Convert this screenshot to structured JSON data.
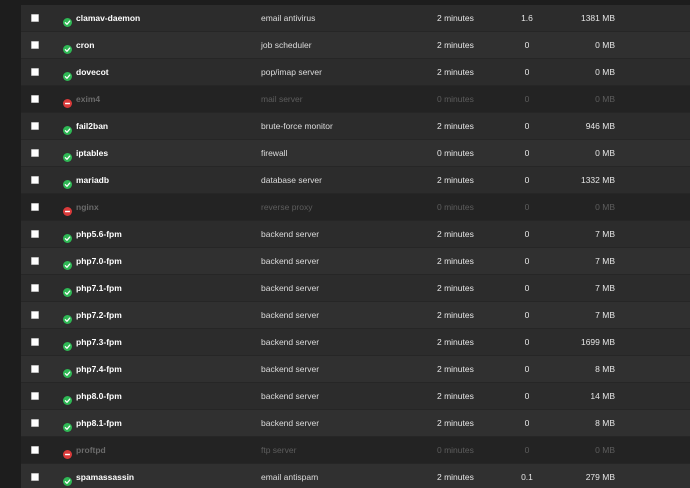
{
  "colors": {
    "running": "#2fb855",
    "stopped": "#d93a3a"
  },
  "services": [
    {
      "name": "clamav-daemon",
      "description": "email antivirus",
      "uptime": "2 minutes",
      "cpu": "1.6",
      "memory": "1381 MB",
      "status": "running",
      "status_icon": "check-circle-icon"
    },
    {
      "name": "cron",
      "description": "job scheduler",
      "uptime": "2 minutes",
      "cpu": "0",
      "memory": "0 MB",
      "status": "running",
      "status_icon": "check-circle-icon"
    },
    {
      "name": "dovecot",
      "description": "pop/imap server",
      "uptime": "2 minutes",
      "cpu": "0",
      "memory": "0 MB",
      "status": "running",
      "status_icon": "check-circle-icon"
    },
    {
      "name": "exim4",
      "description": "mail server",
      "uptime": "0 minutes",
      "cpu": "0",
      "memory": "0 MB",
      "status": "stopped",
      "status_icon": "minus-circle-icon"
    },
    {
      "name": "fail2ban",
      "description": "brute-force monitor",
      "uptime": "2 minutes",
      "cpu": "0",
      "memory": "946 MB",
      "status": "running",
      "status_icon": "check-circle-icon"
    },
    {
      "name": "iptables",
      "description": "firewall",
      "uptime": "0 minutes",
      "cpu": "0",
      "memory": "0 MB",
      "status": "running",
      "status_icon": "check-circle-icon"
    },
    {
      "name": "mariadb",
      "description": "database server",
      "uptime": "2 minutes",
      "cpu": "0",
      "memory": "1332 MB",
      "status": "running",
      "status_icon": "check-circle-icon"
    },
    {
      "name": "nginx",
      "description": "reverse proxy",
      "uptime": "0 minutes",
      "cpu": "0",
      "memory": "0 MB",
      "status": "stopped",
      "status_icon": "minus-circle-icon"
    },
    {
      "name": "php5.6-fpm",
      "description": "backend server",
      "uptime": "2 minutes",
      "cpu": "0",
      "memory": "7 MB",
      "status": "running",
      "status_icon": "check-circle-icon"
    },
    {
      "name": "php7.0-fpm",
      "description": "backend server",
      "uptime": "2 minutes",
      "cpu": "0",
      "memory": "7 MB",
      "status": "running",
      "status_icon": "check-circle-icon"
    },
    {
      "name": "php7.1-fpm",
      "description": "backend server",
      "uptime": "2 minutes",
      "cpu": "0",
      "memory": "7 MB",
      "status": "running",
      "status_icon": "check-circle-icon"
    },
    {
      "name": "php7.2-fpm",
      "description": "backend server",
      "uptime": "2 minutes",
      "cpu": "0",
      "memory": "7 MB",
      "status": "running",
      "status_icon": "check-circle-icon"
    },
    {
      "name": "php7.3-fpm",
      "description": "backend server",
      "uptime": "2 minutes",
      "cpu": "0",
      "memory": "1699 MB",
      "status": "running",
      "status_icon": "check-circle-icon"
    },
    {
      "name": "php7.4-fpm",
      "description": "backend server",
      "uptime": "2 minutes",
      "cpu": "0",
      "memory": "8 MB",
      "status": "running",
      "status_icon": "check-circle-icon"
    },
    {
      "name": "php8.0-fpm",
      "description": "backend server",
      "uptime": "2 minutes",
      "cpu": "0",
      "memory": "14 MB",
      "status": "running",
      "status_icon": "check-circle-icon"
    },
    {
      "name": "php8.1-fpm",
      "description": "backend server",
      "uptime": "2 minutes",
      "cpu": "0",
      "memory": "8 MB",
      "status": "running",
      "status_icon": "check-circle-icon"
    },
    {
      "name": "proftpd",
      "description": "ftp server",
      "uptime": "0 minutes",
      "cpu": "0",
      "memory": "0 MB",
      "status": "stopped",
      "status_icon": "minus-circle-icon"
    },
    {
      "name": "spamassassin",
      "description": "email antispam",
      "uptime": "2 minutes",
      "cpu": "0.1",
      "memory": "279 MB",
      "status": "running",
      "status_icon": "check-circle-icon"
    }
  ]
}
